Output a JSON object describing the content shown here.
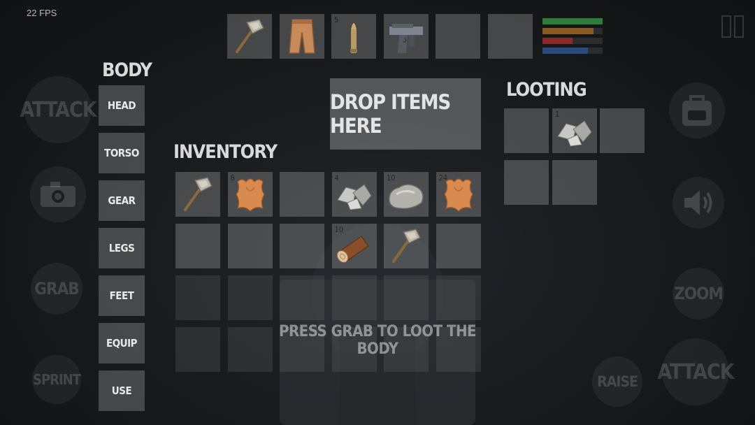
{
  "fps": "22 FPS",
  "body_heading": "BODY",
  "body_slots": [
    "HEAD",
    "TORSO",
    "GEAR",
    "LEGS",
    "FEET",
    "EQUIP",
    "USE"
  ],
  "inventory_heading": "INVENTORY",
  "looting_heading": "LOOTING",
  "drop_zone_label": "DROP ITEMS HERE",
  "hint": "PRESS GRAB TO LOOT THE BODY",
  "hotbar": [
    {
      "item": "stone-hammer",
      "count": ""
    },
    {
      "item": "leather-pants",
      "count": ""
    },
    {
      "item": "bullet",
      "count": "5"
    },
    {
      "item": "pistol",
      "count": ""
    },
    {
      "item": "",
      "count": ""
    },
    {
      "item": "",
      "count": ""
    }
  ],
  "status_bars": [
    {
      "color": "#2f7d3a",
      "level": 1.0
    },
    {
      "color": "#8a5a1f",
      "level": 0.85
    },
    {
      "color": "#8b2a2a",
      "level": 0.5
    },
    {
      "color": "#2a4a7d",
      "level": 0.75
    }
  ],
  "inventory": [
    {
      "item": "stone-hammer",
      "count": ""
    },
    {
      "item": "hide",
      "count": "6"
    },
    {
      "item": "",
      "count": ""
    },
    {
      "item": "stones",
      "count": "4"
    },
    {
      "item": "rock",
      "count": "10"
    },
    {
      "item": "hide",
      "count": "24"
    },
    {
      "item": "",
      "count": ""
    },
    {
      "item": "",
      "count": ""
    },
    {
      "item": "",
      "count": ""
    },
    {
      "item": "log",
      "count": "10"
    },
    {
      "item": "stone-hammer",
      "count": ""
    },
    {
      "item": "",
      "count": ""
    }
  ],
  "looting": [
    {
      "item": "",
      "count": ""
    },
    {
      "item": "stones",
      "count": "1"
    },
    {
      "item": "",
      "count": ""
    },
    {
      "item": "",
      "count": ""
    },
    {
      "item": "",
      "count": ""
    }
  ],
  "left_controls": [
    "ATTACK",
    "camera",
    "GRAB",
    "SPRINT"
  ],
  "right_controls": [
    "backpack",
    "speaker",
    "ZOOM",
    "RAISE",
    "ATTACK"
  ],
  "controls": {
    "attack_left": "ATTACK",
    "grab": "GRAB",
    "sprint": "SPRINT",
    "zoom": "ZOOM",
    "raise": "RAISE",
    "attack_right": "ATTACK"
  }
}
